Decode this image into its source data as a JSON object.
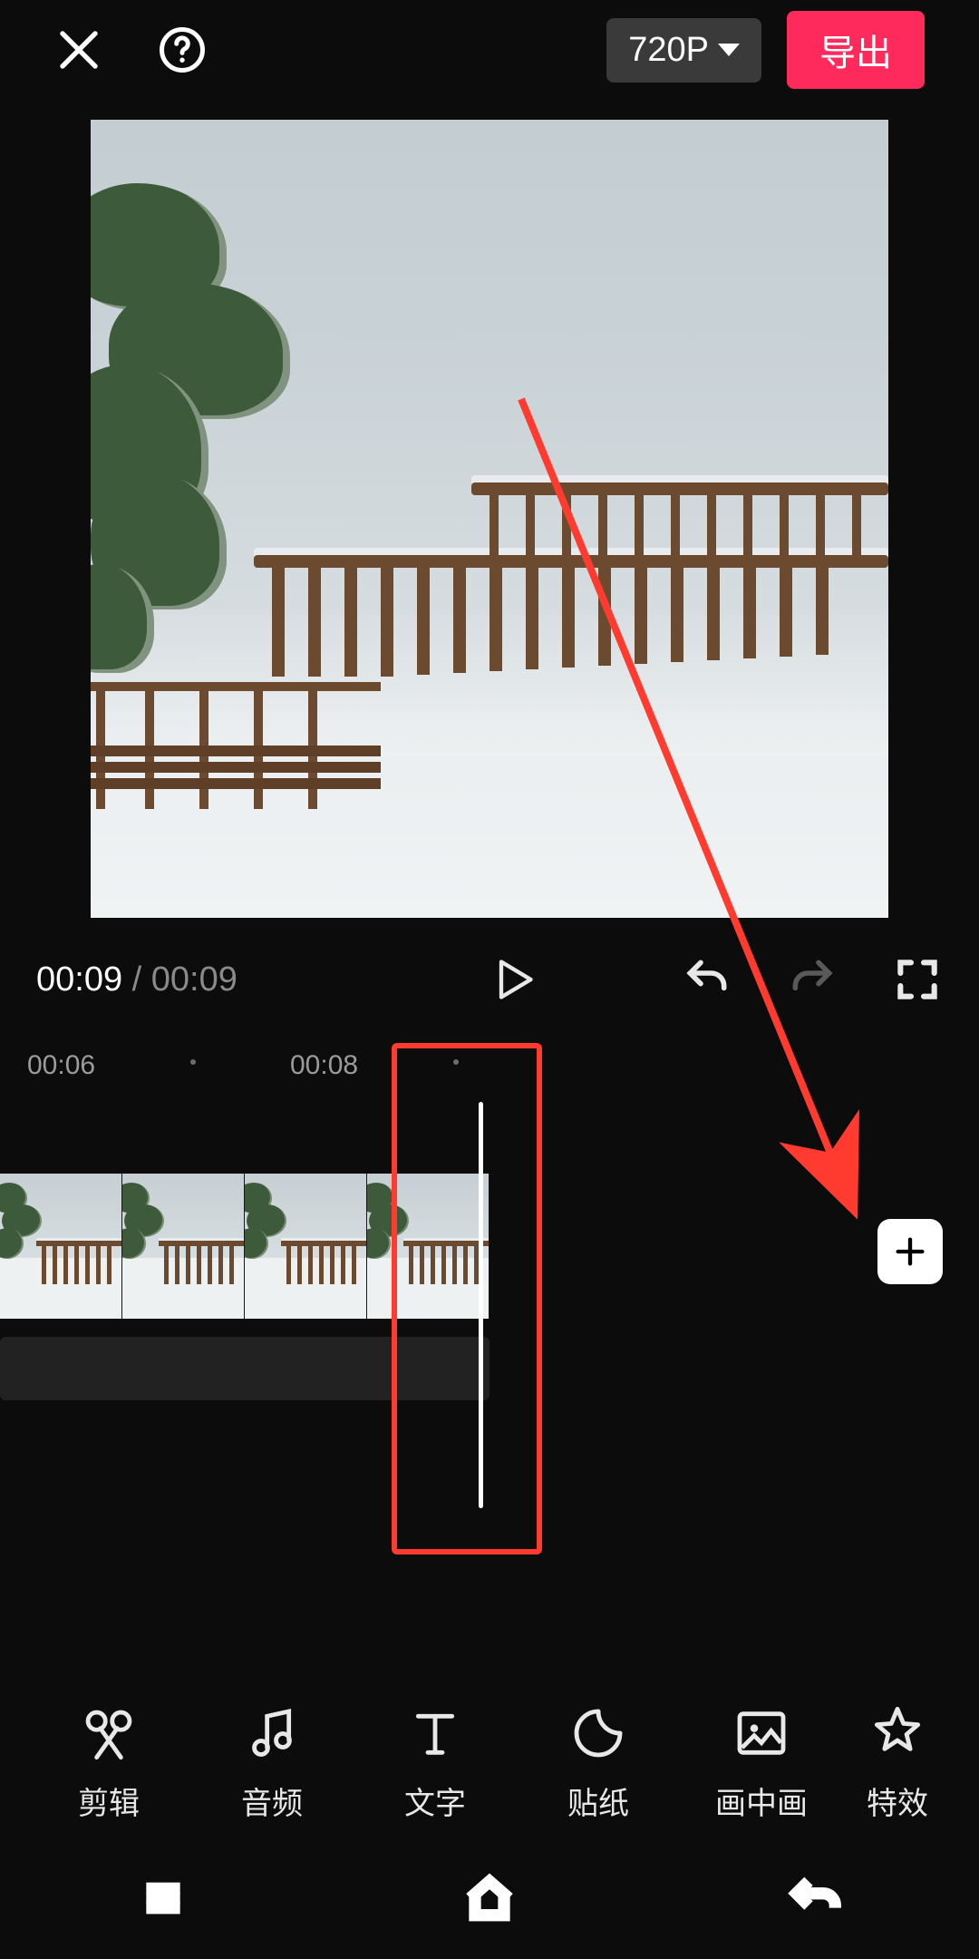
{
  "topbar": {
    "resolution_label": "720P",
    "export_label": "导出"
  },
  "playback": {
    "current_time": "00:09",
    "separator": " / ",
    "total_time": "00:09"
  },
  "ruler": {
    "ticks": [
      "00:06",
      "00:08"
    ]
  },
  "toolbar": {
    "items": [
      {
        "id": "edit",
        "label": "剪辑"
      },
      {
        "id": "audio",
        "label": "音频"
      },
      {
        "id": "text",
        "label": "文字"
      },
      {
        "id": "sticker",
        "label": "贴纸"
      },
      {
        "id": "pip",
        "label": "画中画"
      },
      {
        "id": "fx",
        "label": "特效"
      }
    ]
  },
  "colors": {
    "accent": "#ff2a5c",
    "annotation": "#ff3b30"
  }
}
